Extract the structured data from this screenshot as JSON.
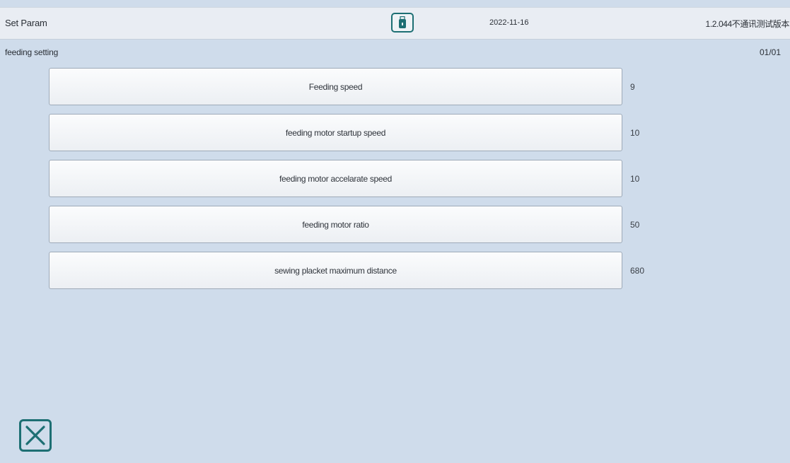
{
  "header": {
    "title": "Set Param",
    "usb_icon": "usb-drive-icon",
    "date": "2022-11-16",
    "version": "1.2.044不通讯测试版本"
  },
  "subheader": {
    "section": "feeding setting",
    "page": "01/01"
  },
  "params": [
    {
      "label": "Feeding speed",
      "value": "9"
    },
    {
      "label": "feeding motor startup speed",
      "value": "10"
    },
    {
      "label": "feeding motor accelarate speed",
      "value": "10"
    },
    {
      "label": "feeding motor ratio",
      "value": "50"
    },
    {
      "label": "sewing placket maximum distance",
      "value": "680"
    }
  ],
  "footer": {
    "close_icon": "close-icon"
  },
  "colors": {
    "background": "#cfdceb",
    "header": "#e9edf3",
    "accent": "#1d6f73"
  }
}
